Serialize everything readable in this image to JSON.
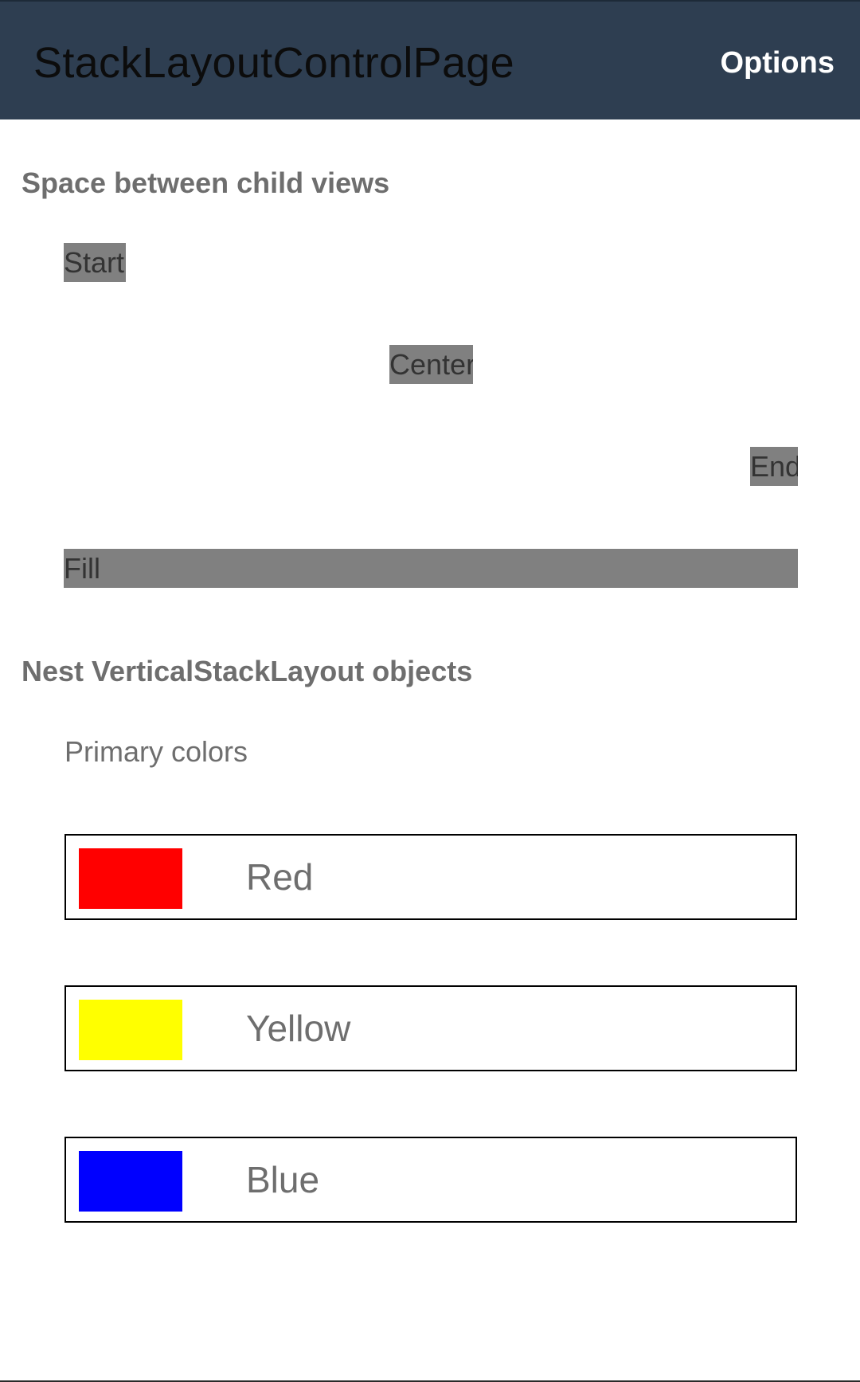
{
  "appbar": {
    "title": "StackLayoutControlPage",
    "options_label": "Options",
    "background": "#2e3e51"
  },
  "section_spacing": {
    "heading": "Space between child views",
    "labels": {
      "start": "Start",
      "center": "Center",
      "end": "End",
      "fill": "Fill"
    }
  },
  "section_nesting": {
    "heading": "Nest VerticalStackLayout objects",
    "subheading": "Primary colors",
    "colors": [
      {
        "label": "Red",
        "swatch": "#ff0000"
      },
      {
        "label": "Yellow",
        "swatch": "#ffff00"
      },
      {
        "label": "Blue",
        "swatch": "#0000ff"
      }
    ]
  }
}
